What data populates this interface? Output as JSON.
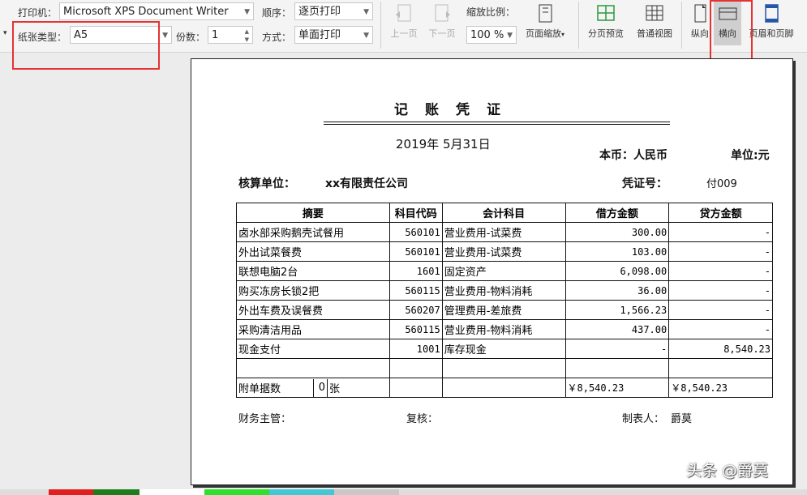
{
  "toolbar": {
    "printer_label": "打印机：",
    "printer_value": "Microsoft XPS Document Writer",
    "order_label": "顺序：",
    "order_value": "逐页打印",
    "paper_label": "纸张类型：",
    "paper_value": "A5",
    "copies_label": "份数：",
    "copies_value": "1",
    "mode_label": "方式：",
    "mode_value": "单面打印",
    "prev_page": "上一页",
    "next_page": "下一页",
    "zoom_label": "缩放比例：",
    "zoom_value": "100 %",
    "page_zoom": "页面缩放",
    "page_break_preview": "分页预览",
    "normal_view": "普通视图",
    "portrait": "纵向",
    "landscape": "横向",
    "header_footer": "页眉和页脚"
  },
  "voucher": {
    "title": "记　账　凭　证",
    "date": "2019年 5月31日",
    "currency": "本币：人民币",
    "unit": "单位:元",
    "org_label": "核算单位：",
    "org_value": "xx有限责任公司",
    "voucher_no_label": "凭证号：",
    "voucher_no_value": "付009",
    "headers": [
      "摘要",
      "科目代码",
      "会计科目",
      "借方金额",
      "贷方金额"
    ],
    "rows": [
      [
        "卤水部采购鹅壳试餐用",
        "560101",
        "营业费用-试菜费",
        "300.00",
        "-"
      ],
      [
        "外出试菜餐费",
        "560101",
        "营业费用-试菜费",
        "103.00",
        "-"
      ],
      [
        "联想电脑2台",
        "1601",
        "固定资产",
        "6,098.00",
        "-"
      ],
      [
        "购买冻房长锁2把",
        "560115",
        "营业费用-物料消耗",
        "36.00",
        "-"
      ],
      [
        "外出车费及误餐费",
        "560207",
        "管理费用-差旅费",
        "1,566.23",
        "-"
      ],
      [
        "采购清洁用品",
        "560115",
        "营业费用-物料消耗",
        "437.00",
        "-"
      ],
      [
        "现金支付",
        "1001",
        "库存现金",
        "-",
        "8,540.23"
      ],
      [
        "",
        "",
        "",
        "",
        ""
      ]
    ],
    "attach_label": "附单据数",
    "attach_count": "0",
    "attach_unit": "张",
    "debit_total": "￥8,540.23",
    "credit_total": "￥8,540.23",
    "finance_manager": "财务主管：",
    "reviewer": "复核：",
    "preparer_label": "制表人：",
    "preparer_value": "爵莫"
  },
  "watermark": "头条 @爵莫"
}
